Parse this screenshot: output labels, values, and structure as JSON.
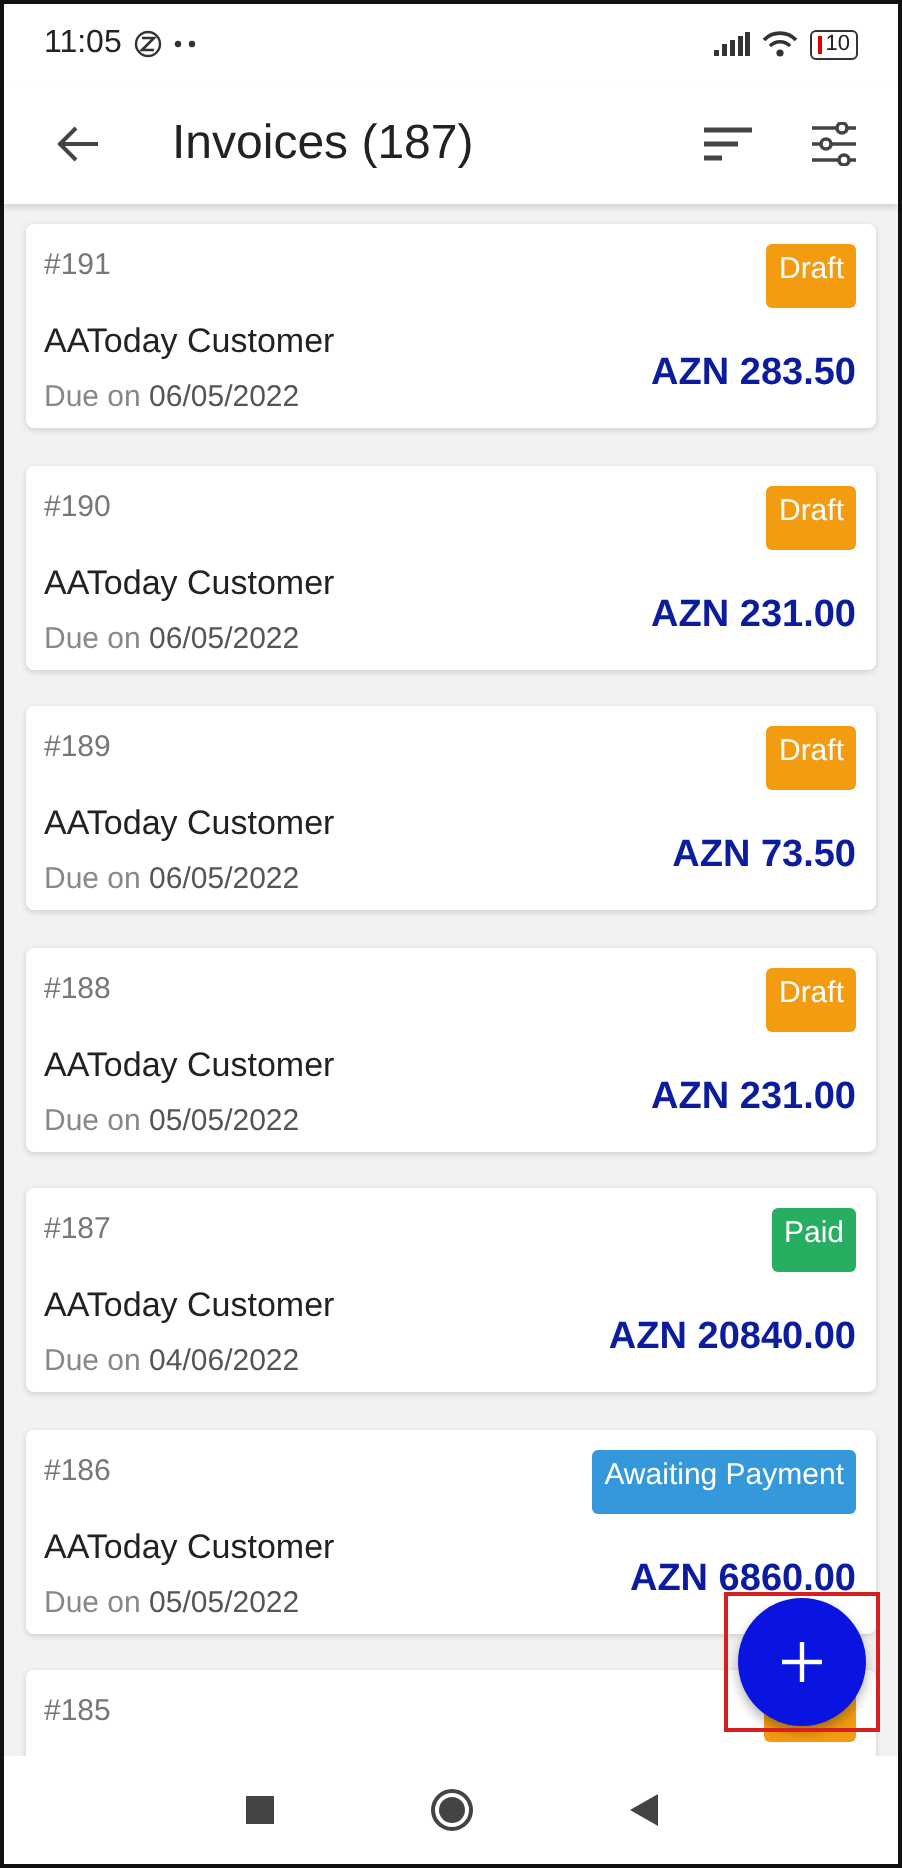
{
  "status_bar": {
    "time": "11:05",
    "battery": "10"
  },
  "header": {
    "title": "Invoices (187)"
  },
  "invoices": [
    {
      "number": "#191",
      "customer": "AAToday Customer",
      "due_label": "Due on",
      "due_date": "06/05/2022",
      "amount": "AZN 283.50",
      "status": {
        "label": "Draft",
        "color": "#f39c12"
      }
    },
    {
      "number": "#190",
      "customer": "AAToday Customer",
      "due_label": "Due on",
      "due_date": "06/05/2022",
      "amount": "AZN 231.00",
      "status": {
        "label": "Draft",
        "color": "#f39c12"
      }
    },
    {
      "number": "#189",
      "customer": "AAToday Customer",
      "due_label": "Due on",
      "due_date": "06/05/2022",
      "amount": "AZN 73.50",
      "status": {
        "label": "Draft",
        "color": "#f39c12"
      }
    },
    {
      "number": "#188",
      "customer": "AAToday Customer",
      "due_label": "Due on",
      "due_date": "05/05/2022",
      "amount": "AZN 231.00",
      "status": {
        "label": "Draft",
        "color": "#f39c12"
      }
    },
    {
      "number": "#187",
      "customer": "AAToday Customer",
      "due_label": "Due on",
      "due_date": "04/06/2022",
      "amount": "AZN 20840.00",
      "status": {
        "label": "Paid",
        "color": "#27ae60"
      }
    },
    {
      "number": "#186",
      "customer": "AAToday Customer",
      "due_label": "Due on",
      "due_date": "05/05/2022",
      "amount": "AZN 6860.00",
      "status": {
        "label": "Awaiting Payment",
        "color": "#3498db"
      }
    },
    {
      "number": "#185",
      "status": {
        "color": "#f39c12"
      }
    }
  ]
}
